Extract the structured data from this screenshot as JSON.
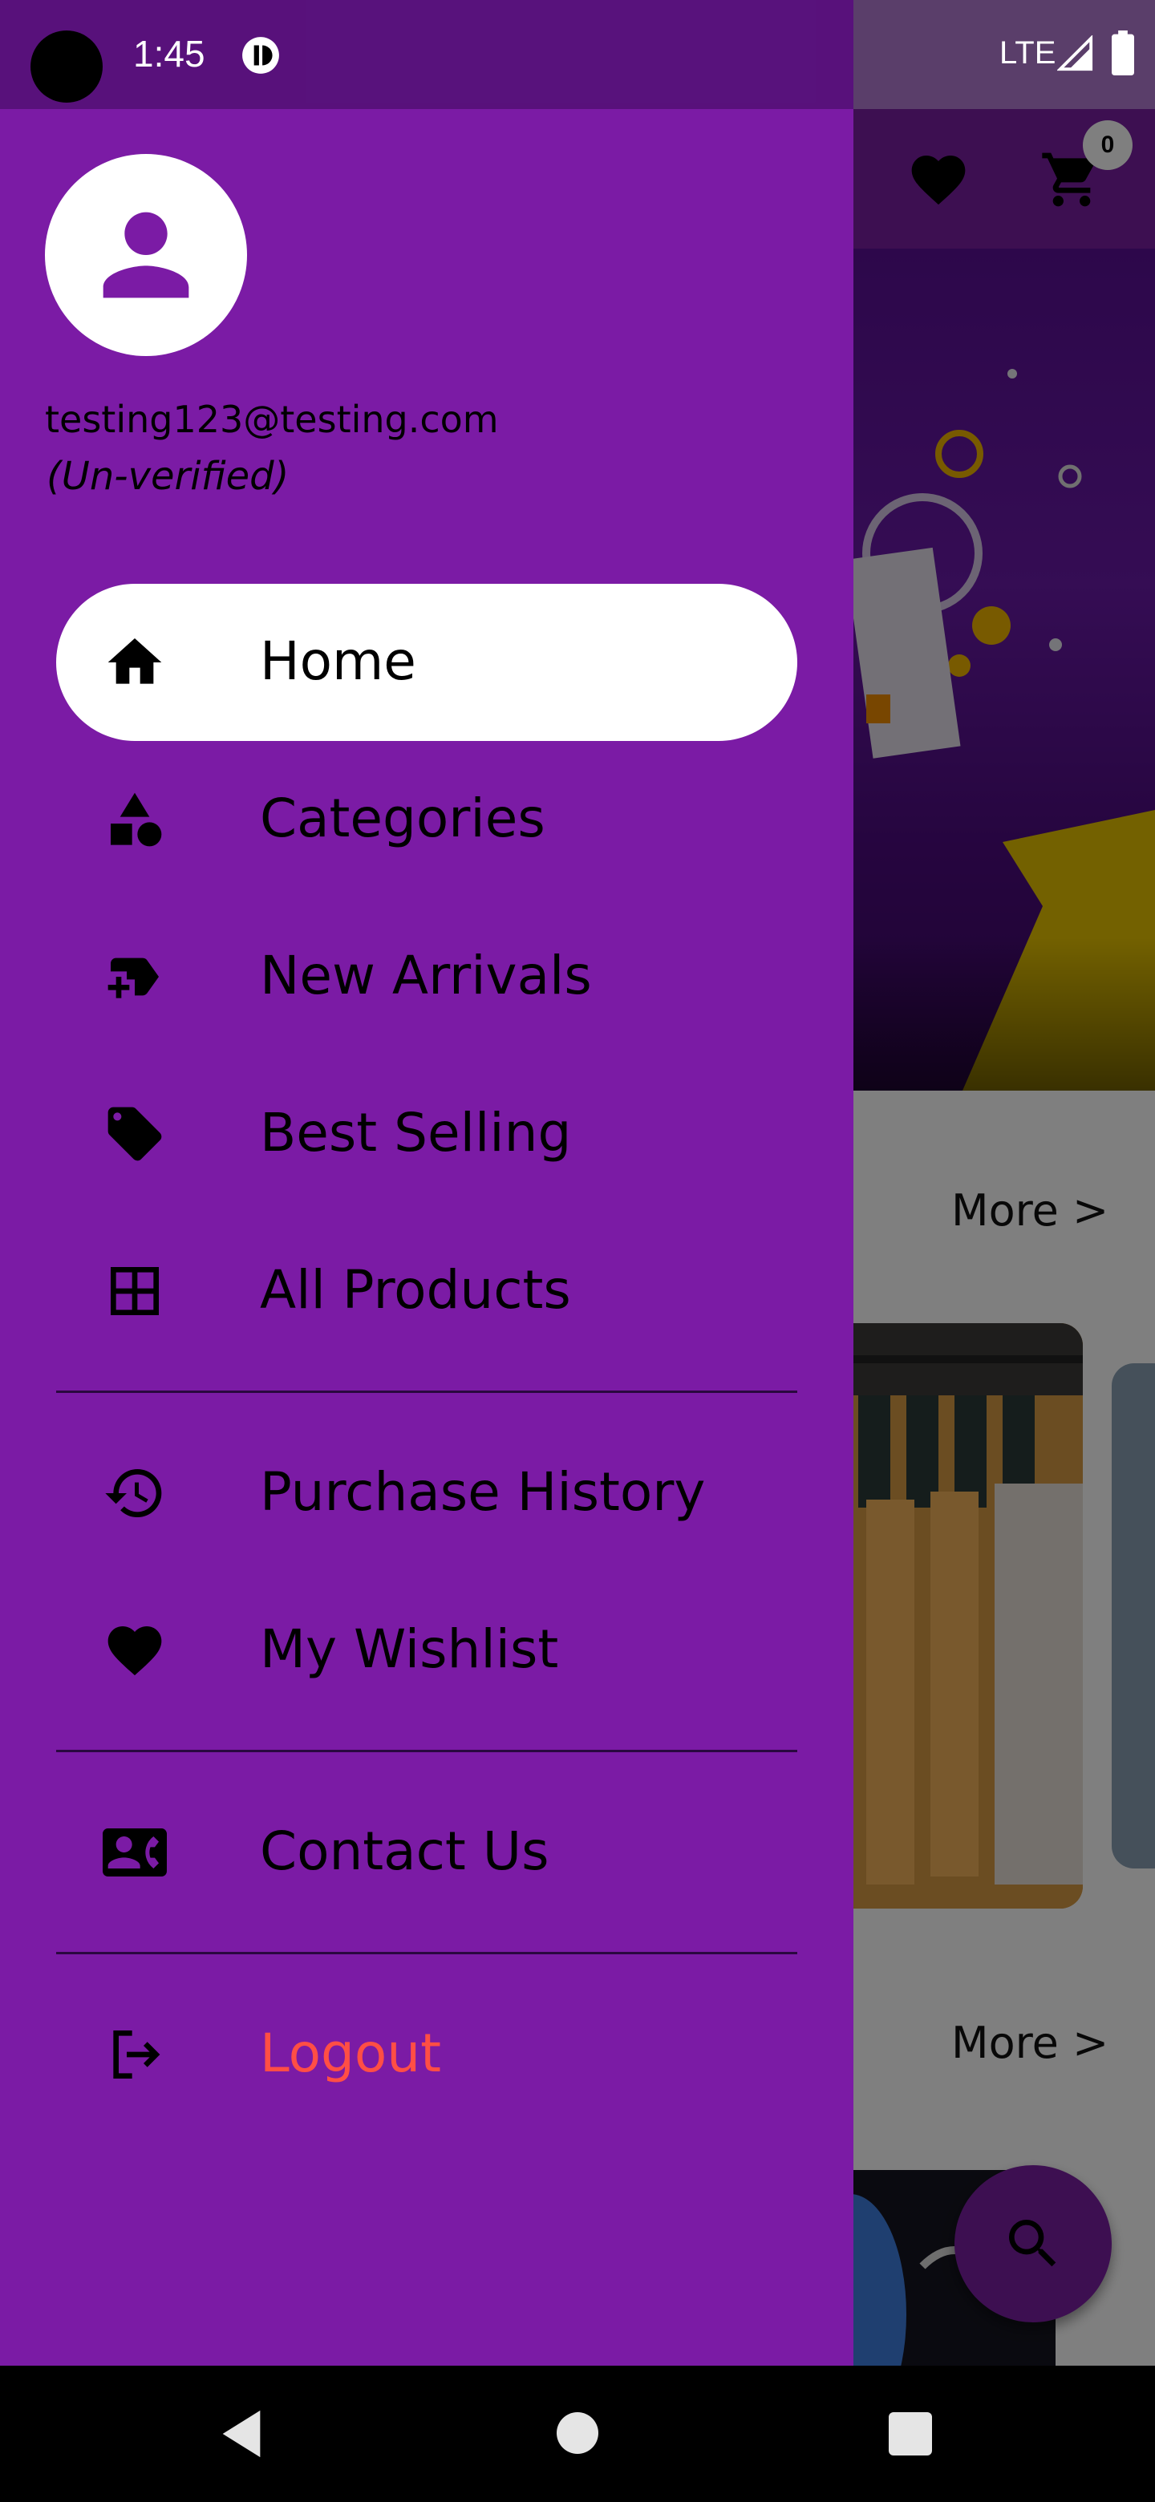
{
  "status_bar": {
    "time": "1:45",
    "network": "LTE"
  },
  "background_app": {
    "cart_count": "0",
    "section1_more": "More >",
    "section2_more": "More >",
    "icons": [
      "favorite-icon",
      "cart-icon",
      "search-icon"
    ]
  },
  "drawer": {
    "email": "testing123@testing.com",
    "verification_status": "(Un-verified)",
    "items": [
      {
        "label": "Home",
        "icon": "home-icon",
        "active": true
      },
      {
        "label": "Categories",
        "icon": "category-icon"
      },
      {
        "label": "New Arrivals",
        "icon": "new-label-icon"
      },
      {
        "label": "Best Selling",
        "icon": "tag-icon"
      },
      {
        "label": "All Products",
        "icon": "grid-icon"
      },
      {
        "label": "Purchase History",
        "icon": "history-icon"
      },
      {
        "label": "My Wishlist",
        "icon": "heart-icon"
      },
      {
        "label": "Contact Us",
        "icon": "contact-card-icon"
      },
      {
        "label": "Logout",
        "icon": "logout-icon"
      }
    ]
  },
  "colors": {
    "drawer_bg": "#7b1ba5",
    "logout_text": "#ff4e45",
    "active_item_bg": "#ffffff"
  }
}
